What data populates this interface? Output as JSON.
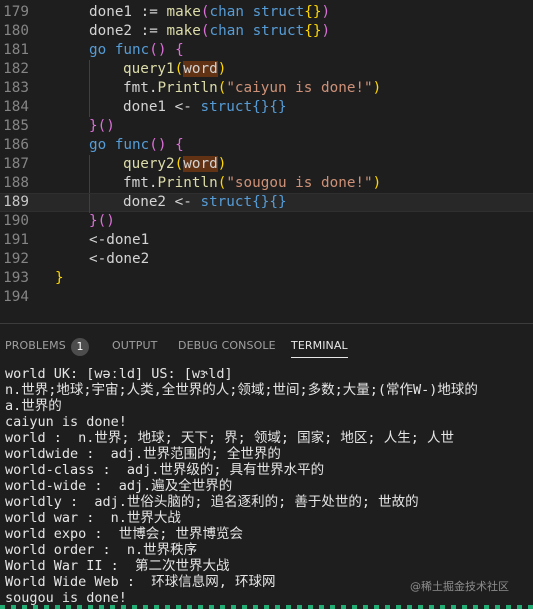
{
  "editor": {
    "lines": [
      {
        "number": "179",
        "tokens": [
          {
            "t": "done1 := ",
            "c": "t-plain"
          },
          {
            "t": "make",
            "c": "t-fn"
          },
          {
            "t": "(",
            "c": "t-par"
          },
          {
            "t": "chan",
            "c": "t-kw"
          },
          {
            "t": " ",
            "c": "t-plain"
          },
          {
            "t": "struct",
            "c": "t-kw"
          },
          {
            "t": "{}",
            "c": "t-brace"
          },
          {
            "t": ")",
            "c": "t-par"
          }
        ],
        "indent": 1
      },
      {
        "number": "180",
        "tokens": [
          {
            "t": "done2 := ",
            "c": "t-plain"
          },
          {
            "t": "make",
            "c": "t-fn"
          },
          {
            "t": "(",
            "c": "t-par"
          },
          {
            "t": "chan",
            "c": "t-kw"
          },
          {
            "t": " ",
            "c": "t-plain"
          },
          {
            "t": "struct",
            "c": "t-kw"
          },
          {
            "t": "{}",
            "c": "t-brace"
          },
          {
            "t": ")",
            "c": "t-par"
          }
        ],
        "indent": 1
      },
      {
        "number": "181",
        "tokens": [
          {
            "t": "go",
            "c": "t-kw"
          },
          {
            "t": " ",
            "c": "t-plain"
          },
          {
            "t": "func",
            "c": "t-kw"
          },
          {
            "t": "()",
            "c": "t-par"
          },
          {
            "t": " ",
            "c": "t-plain"
          },
          {
            "t": "{",
            "c": "t-par"
          }
        ],
        "indent": 1
      },
      {
        "number": "182",
        "tokens": [
          {
            "t": "query1",
            "c": "t-fn"
          },
          {
            "t": "(",
            "c": "t-brace"
          },
          {
            "t": "word",
            "c": "t-hl"
          },
          {
            "t": ")",
            "c": "t-brace"
          }
        ],
        "indent": 2
      },
      {
        "number": "183",
        "tokens": [
          {
            "t": "fmt.",
            "c": "t-plain"
          },
          {
            "t": "Println",
            "c": "t-fn"
          },
          {
            "t": "(",
            "c": "t-brace"
          },
          {
            "t": "\"caiyun is done!\"",
            "c": "t-str"
          },
          {
            "t": ")",
            "c": "t-brace"
          }
        ],
        "indent": 2
      },
      {
        "number": "184",
        "tokens": [
          {
            "t": "done1 <- ",
            "c": "t-plain"
          },
          {
            "t": "struct",
            "c": "t-kw"
          },
          {
            "t": "{}{}",
            "c": "t-kw"
          }
        ],
        "indent": 2
      },
      {
        "number": "185",
        "tokens": [
          {
            "t": "}",
            "c": "t-par"
          },
          {
            "t": "()",
            "c": "t-par"
          }
        ],
        "indent": 1
      },
      {
        "number": "186",
        "tokens": [
          {
            "t": "go",
            "c": "t-kw"
          },
          {
            "t": " ",
            "c": "t-plain"
          },
          {
            "t": "func",
            "c": "t-kw"
          },
          {
            "t": "()",
            "c": "t-par"
          },
          {
            "t": " ",
            "c": "t-plain"
          },
          {
            "t": "{",
            "c": "t-par"
          }
        ],
        "indent": 1
      },
      {
        "number": "187",
        "tokens": [
          {
            "t": "query2",
            "c": "t-fn"
          },
          {
            "t": "(",
            "c": "t-brace"
          },
          {
            "t": "word",
            "c": "t-hl"
          },
          {
            "t": ")",
            "c": "t-brace"
          }
        ],
        "indent": 2
      },
      {
        "number": "188",
        "tokens": [
          {
            "t": "fmt.",
            "c": "t-plain"
          },
          {
            "t": "Println",
            "c": "t-fn"
          },
          {
            "t": "(",
            "c": "t-brace"
          },
          {
            "t": "\"sougou is done!\"",
            "c": "t-str"
          },
          {
            "t": ")",
            "c": "t-brace"
          }
        ],
        "indent": 2
      },
      {
        "number": "189",
        "tokens": [
          {
            "t": "done2 <- ",
            "c": "t-plain"
          },
          {
            "t": "struct",
            "c": "t-kw"
          },
          {
            "t": "{}{}",
            "c": "t-kw"
          }
        ],
        "indent": 2,
        "current": true
      },
      {
        "number": "190",
        "tokens": [
          {
            "t": "}",
            "c": "t-par"
          },
          {
            "t": "()",
            "c": "t-par"
          }
        ],
        "indent": 1
      },
      {
        "number": "191",
        "tokens": [
          {
            "t": "<-done1",
            "c": "t-plain"
          }
        ],
        "indent": 1
      },
      {
        "number": "192",
        "tokens": [
          {
            "t": "<-done2",
            "c": "t-plain"
          }
        ],
        "indent": 1
      },
      {
        "number": "193",
        "tokens": [
          {
            "t": "}",
            "c": "t-brace"
          }
        ],
        "indent": 0
      },
      {
        "number": "194",
        "tokens": [],
        "indent": 0
      }
    ]
  },
  "panel": {
    "tabs": [
      {
        "label": "PROBLEMS",
        "name": "tab-problems"
      },
      {
        "label": "OUTPUT",
        "name": "tab-output"
      },
      {
        "label": "DEBUG CONSOLE",
        "name": "tab-debug-console"
      },
      {
        "label": "TERMINAL",
        "name": "tab-terminal",
        "active": true
      }
    ],
    "problems_count": "1"
  },
  "terminal": {
    "lines": [
      "world UK: [wəːld] US: [wɝld]",
      "n.世界;地球;宇宙;人类,全世界的人;领域;世间;多数;大量;(常作W-)地球的",
      "a.世界的",
      "caiyun is done!",
      "world :  n.世界; 地球; 天下; 界; 领域; 国家; 地区; 人生; 人世",
      "worldwide :  adj.世界范围的; 全世界的",
      "world-class :  adj.世界级的; 具有世界水平的",
      "world-wide :  adj.遍及全世界的",
      "worldly :  adj.世俗头脑的; 追名逐利的; 善于处世的; 世故的",
      "world war :  n.世界大战",
      "world expo :  世博会; 世界博览会",
      "world order :  n.世界秩序",
      "World War II :  第二次世界大战",
      "World Wide Web :  环球信息网, 环球网",
      "sougou is done!"
    ],
    "watermark": "@稀土掘金技术社区"
  }
}
